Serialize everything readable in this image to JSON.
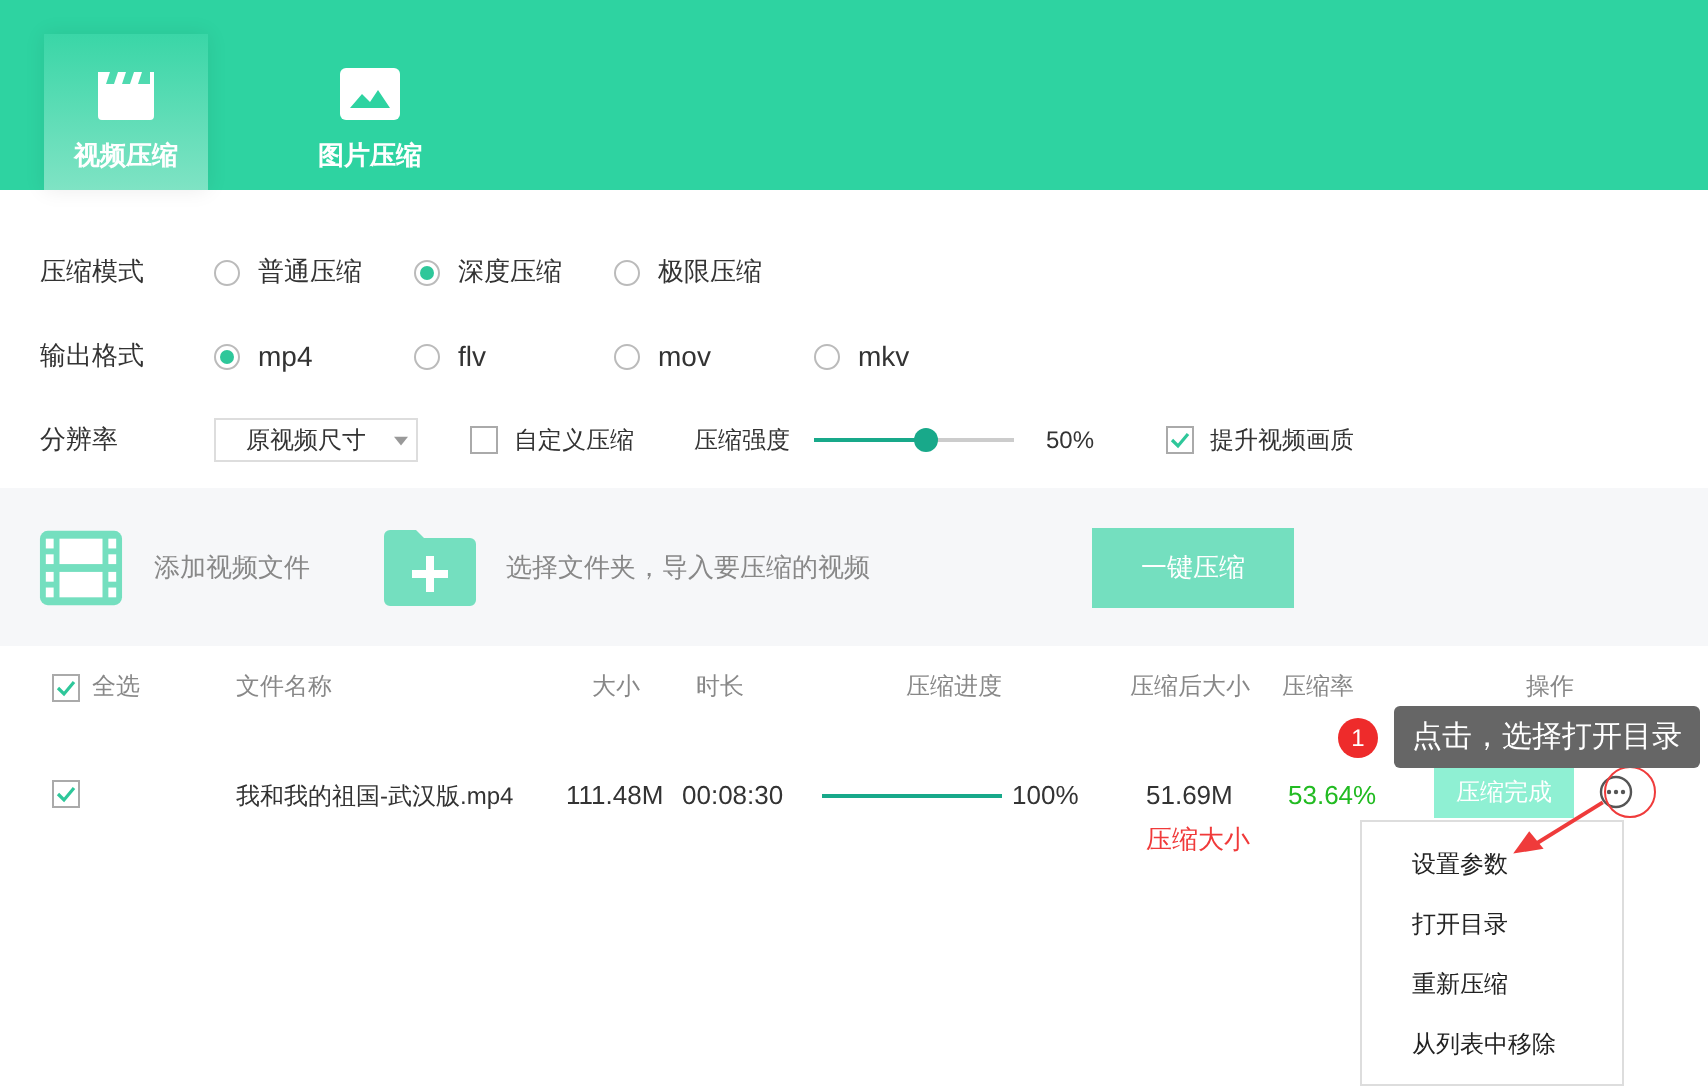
{
  "tabs": [
    {
      "label": "视频压缩",
      "kind": "video",
      "selected": true
    },
    {
      "label": "图片压缩",
      "kind": "image",
      "selected": false
    }
  ],
  "settings": {
    "mode": {
      "label": "压缩模式",
      "options": [
        {
          "label": "普通压缩",
          "selected": false
        },
        {
          "label": "深度压缩",
          "selected": true
        },
        {
          "label": "极限压缩",
          "selected": false
        }
      ]
    },
    "format": {
      "label": "输出格式",
      "options": [
        {
          "label": "mp4",
          "selected": true
        },
        {
          "label": "flv",
          "selected": false
        },
        {
          "label": "mov",
          "selected": false
        },
        {
          "label": "mkv",
          "selected": false
        }
      ]
    },
    "resolution": {
      "label": "分辨率",
      "value": "原视频尺寸"
    },
    "custom": {
      "label": "自定义压缩",
      "checked": false
    },
    "strength": {
      "label": "压缩强度",
      "level": 0.5,
      "reading": "50%"
    },
    "enhance": {
      "label": "提升视频画质",
      "checked": true
    }
  },
  "toolbar": {
    "add_file": "添加视频文件",
    "add_folder": "选择文件夹，导入要压缩的视频",
    "compress_button": "一键压缩"
  },
  "table": {
    "select_all": {
      "label": "全选",
      "checked": true
    },
    "columns": [
      "文件名称",
      "大小",
      "时长",
      "压缩进度",
      "压缩后大小",
      "压缩率",
      "操作"
    ],
    "rows": [
      {
        "checked": true,
        "name": "我和我的祖国-武汉版.mp4",
        "size": "111.48M",
        "duration": "00:08:30",
        "progress": {
          "level": 1,
          "reading": "100%"
        },
        "compressed_size": "51.69M",
        "note": "压缩大小",
        "ratio": "53.64%",
        "status": "压缩完成"
      }
    ]
  },
  "menu": [
    "设置参数",
    "打开目录",
    "重新压缩",
    "从列表中移除"
  ],
  "tooltip": {
    "badge": "1",
    "text": "点击，选择打开目录"
  }
}
